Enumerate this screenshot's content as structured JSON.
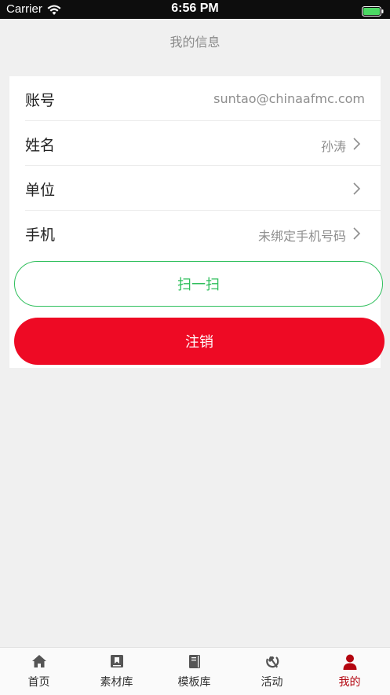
{
  "status_bar": {
    "carrier": "Carrier",
    "time": "6:56 PM",
    "icons": [
      "wifi-icon",
      "battery-icon"
    ]
  },
  "header": {
    "title": "我的信息"
  },
  "profile": {
    "rows": [
      {
        "label": "账号",
        "value": "suntao@chinaafmc.com",
        "chevron": false
      },
      {
        "label": "姓名",
        "value": "孙涛",
        "chevron": true
      },
      {
        "label": "单位",
        "value": "",
        "chevron": true
      },
      {
        "label": "手机",
        "value": "未绑定手机号码",
        "chevron": true
      }
    ]
  },
  "actions": {
    "scan_label": "扫一扫",
    "logout_label": "注销"
  },
  "tabbar": {
    "items": [
      {
        "label": "首页",
        "icon": "home-icon",
        "active": false
      },
      {
        "label": "素材库",
        "icon": "material-library-icon",
        "active": false
      },
      {
        "label": "模板库",
        "icon": "template-library-icon",
        "active": false
      },
      {
        "label": "活动",
        "icon": "hammer-sickle-icon",
        "active": false
      },
      {
        "label": "我的",
        "icon": "user-icon",
        "active": true
      }
    ]
  },
  "colors": {
    "accent_green": "#2fbf5c",
    "logout_red": "#ee0a24",
    "active_tab": "#b3050f"
  }
}
